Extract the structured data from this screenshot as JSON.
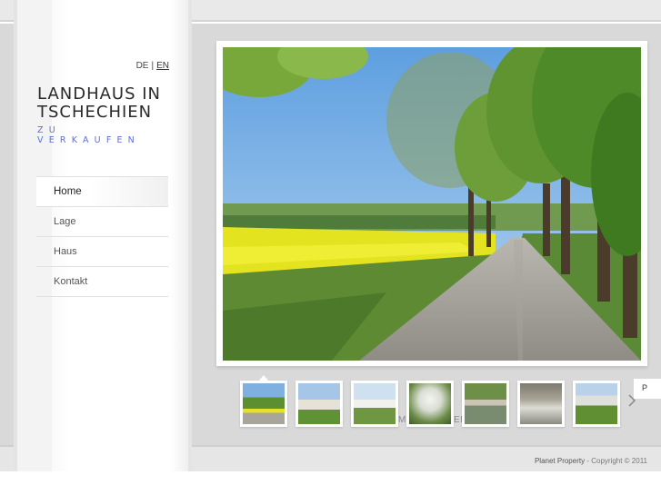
{
  "language": {
    "options": [
      "DE",
      "EN"
    ],
    "separator": "|",
    "selected": "EN"
  },
  "logo": {
    "line1": "LANDHAUS IN",
    "line2": "TSCHECHIEN",
    "line3": "ZU VERKAUFEN"
  },
  "nav": {
    "items": [
      {
        "label": "Home",
        "active": true
      },
      {
        "label": "Lage",
        "active": false
      },
      {
        "label": "Haus",
        "active": false
      },
      {
        "label": "Kontakt",
        "active": false
      }
    ]
  },
  "gallery": {
    "main_image": "country-road-with-trees-and-rapeseed-field",
    "thumbnails": [
      "tree-lined-road",
      "house-with-lawn",
      "farmhouse-and-field",
      "blossoming-tree",
      "pond-with-wall",
      "stone-fountain",
      "house-in-garden"
    ],
    "ghost_left": "MI",
    "ghost_right": "EN",
    "next_arrow": "chevron-right-icon",
    "side_tab": "P"
  },
  "footer": {
    "brand": "Planet Property",
    "copyright": "- Copyright © 2011"
  },
  "colors": {
    "accent": "#5b6fd6",
    "background": "#d9d9d9",
    "text": "#2a2a2a"
  }
}
